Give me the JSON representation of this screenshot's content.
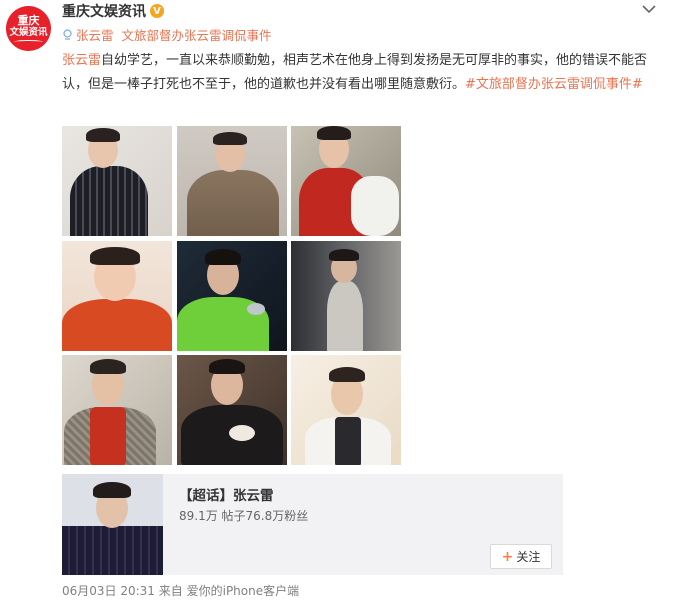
{
  "post": {
    "author": {
      "name": "重庆文娱资讯",
      "avatar_lines": [
        "重庆",
        "文娱资讯"
      ],
      "verified_mark": "V"
    },
    "source_links": [
      "张云雷",
      "文旅部督办张云雷调侃事件"
    ],
    "text_segments": [
      {
        "type": "mention",
        "text": "张云雷"
      },
      {
        "type": "text",
        "text": "自幼学艺，一直以来恭顺勤勉，相声艺术在他身上得到发扬是无可厚非的事实，他的错误不能否认，但是一棒子打死也不至于，他的道歉也并没有看出哪里随意敷衍。"
      },
      {
        "type": "hashtag",
        "text": "#文旅部督办张云雷调侃事件#"
      }
    ],
    "photo_count": 9,
    "topic_card": {
      "title": "【超话】张云雷",
      "stats": "89.1万 帖子76.8万粉丝",
      "follow_label": "关注",
      "follow_icon": "+"
    },
    "footer": {
      "date": "06月03日 20:31",
      "from_label": "来自",
      "client": "爱你的iPhone客户端"
    }
  },
  "colors": {
    "link": "#eb7350",
    "brand_red": "#e8202a",
    "verified": "#f7a421",
    "card_bg": "#f2f2f5"
  },
  "icons": [
    "verified-icon",
    "chevron-down-icon",
    "topic-icon",
    "plus-icon"
  ]
}
